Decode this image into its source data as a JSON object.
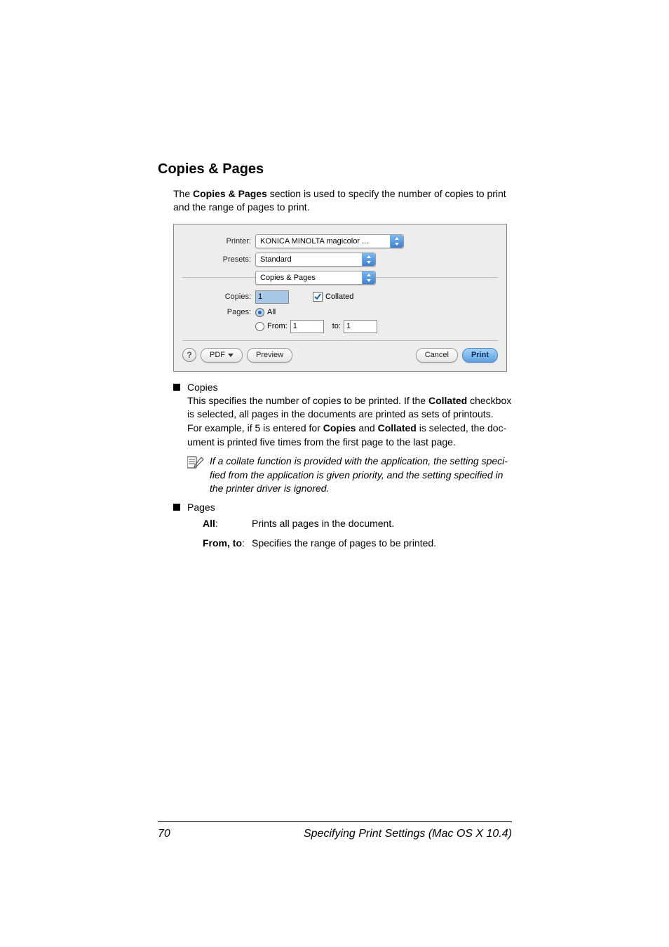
{
  "section": {
    "title": "Copies & Pages",
    "intro_pre": "The",
    "intro_bold": "Copies & Pages",
    "intro_post": "section is used to specify the number of copies to print and the range of pages to print."
  },
  "dialog": {
    "printer_label": "Printer:",
    "printer_value": "KONICA MINOLTA magicolor ...",
    "presets_label": "Presets:",
    "presets_value": "Standard",
    "panel_value": "Copies & Pages",
    "copies_label": "Copies:",
    "copies_value": "1",
    "collated_label": "Collated",
    "pages_label": "Pages:",
    "pages_all": "All",
    "pages_from": "From:",
    "pages_from_val": "1",
    "pages_to": "to:",
    "pages_to_val": "1",
    "help": "?",
    "pdf_btn": "PDF",
    "preview_btn": "Preview",
    "cancel_btn": "Cancel",
    "print_btn": "Print"
  },
  "body": {
    "copies_heading": "Copies",
    "copies_p1a": "This specifies the number of copies to be printed. If the",
    "copies_p1_bold": "Collated",
    "copies_p1b": "check­box is selected, all pages in the documents are printed as sets of print­outs.",
    "copies_p2a": "For example, if 5 is entered for",
    "copies_p2_bold1": "Copies",
    "copies_p2_mid": "and",
    "copies_p2_bold2": "Collated",
    "copies_p2b": "is selected, the doc­ument is printed five times from the first page to the last page.",
    "note": "If a collate function is provided with the application, the setting speci­fied from the application is given priority, and the setting specified in the printer driver is ignored.",
    "pages_heading": "Pages",
    "def_all_term": "All",
    "def_all_colon": ":",
    "def_all_desc": "Prints all pages in the document.",
    "def_fromto_term": "From, to",
    "def_fromto_colon": ":",
    "def_fromto_desc": "Specifies the range of pages to be printed."
  },
  "footer": {
    "page": "70",
    "title": "Specifying Print Settings (Mac OS X 10.4)"
  }
}
